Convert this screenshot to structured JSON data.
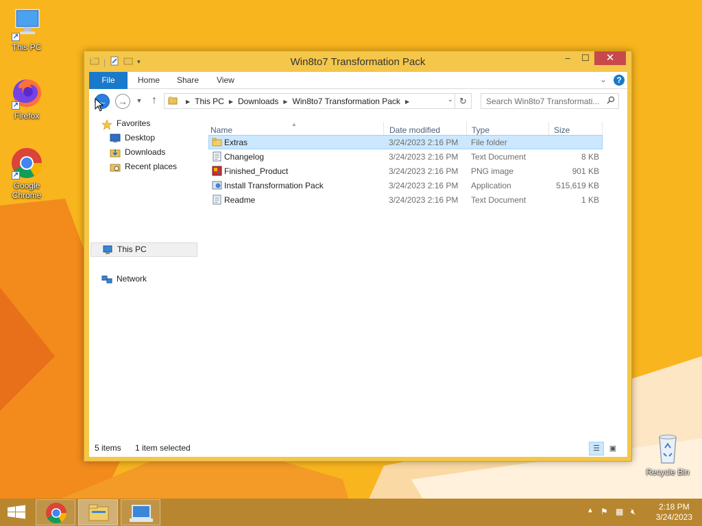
{
  "desktop": {
    "icons": [
      {
        "label": "This PC",
        "icon": "computer-icon"
      },
      {
        "label": "Firefox",
        "icon": "firefox-icon"
      },
      {
        "label": "Google Chrome",
        "icon": "chrome-icon"
      },
      {
        "label": "Recycle Bin",
        "icon": "recycle-bin-icon"
      }
    ],
    "background_color": "#f8b51e"
  },
  "window": {
    "title": "Win8to7 Transformation Pack",
    "controls": {
      "minimize": "–",
      "maximize": "☐",
      "close": "✕"
    }
  },
  "ribbon": {
    "tabs": [
      "File",
      "Home",
      "Share",
      "View"
    ],
    "help": "?"
  },
  "navbar": {
    "breadcrumb": [
      "This PC",
      "Downloads",
      "Win8to7 Transformation Pack"
    ],
    "search_placeholder": "Search Win8to7 Transformati..."
  },
  "navpane": {
    "favorites": "Favorites",
    "favorites_items": [
      "Desktop",
      "Downloads",
      "Recent places"
    ],
    "this_pc": "This PC",
    "network": "Network"
  },
  "files": {
    "columns": [
      "Name",
      "Date modified",
      "Type",
      "Size"
    ],
    "rows": [
      {
        "name": "Extras",
        "date": "3/24/2023 2:16 PM",
        "type": "File folder",
        "size": "",
        "icon": "folder-icon"
      },
      {
        "name": "Changelog",
        "date": "3/24/2023 2:16 PM",
        "type": "Text Document",
        "size": "8 KB",
        "icon": "text-document-icon"
      },
      {
        "name": "Finished_Product",
        "date": "3/24/2023 2:16 PM",
        "type": "PNG image",
        "size": "901 KB",
        "icon": "image-icon"
      },
      {
        "name": "Install Transformation Pack",
        "date": "3/24/2023 2:16 PM",
        "type": "Application",
        "size": "515,619 KB",
        "icon": "application-icon"
      },
      {
        "name": "Readme",
        "date": "3/24/2023 2:16 PM",
        "type": "Text Document",
        "size": "1 KB",
        "icon": "text-document-icon"
      }
    ]
  },
  "status": {
    "item_count": "5 items",
    "selection": "1 item selected"
  },
  "taskbar": {
    "apps": [
      "chrome-icon",
      "file-explorer-icon",
      "control-panel-icon"
    ],
    "clock_time": "2:18 PM",
    "clock_date": "3/24/2023"
  }
}
